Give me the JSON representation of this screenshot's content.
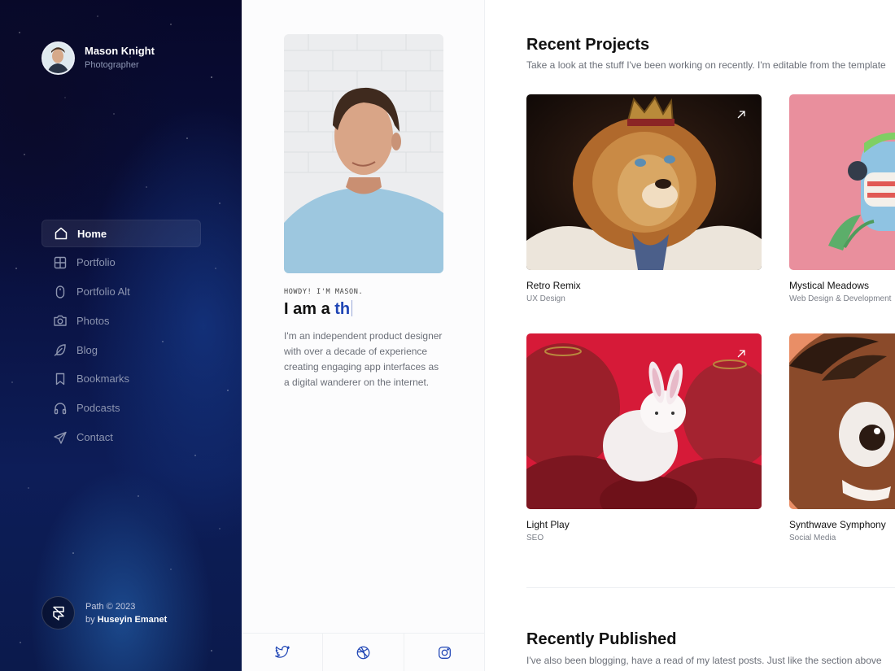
{
  "profile": {
    "name": "Mason Knight",
    "role": "Photographer"
  },
  "nav": {
    "items": [
      {
        "label": "Home",
        "icon": "home-icon",
        "active": true
      },
      {
        "label": "Portfolio",
        "icon": "grid-icon"
      },
      {
        "label": "Portfolio Alt",
        "icon": "mouse-icon"
      },
      {
        "label": "Photos",
        "icon": "camera-icon"
      },
      {
        "label": "Blog",
        "icon": "feather-icon"
      },
      {
        "label": "Bookmarks",
        "icon": "bookmark-icon"
      },
      {
        "label": "Podcasts",
        "icon": "headphones-icon"
      },
      {
        "label": "Contact",
        "icon": "send-icon"
      }
    ]
  },
  "footer": {
    "line1": "Path © 2023",
    "by": "by",
    "author": "Huseyin Emanet"
  },
  "intro": {
    "howdy": "HOWDY! I'M MASON.",
    "headline_prefix": "I am a ",
    "headline_typed": "th",
    "bio": "I'm an independent product designer with over a decade of experience creating engaging app interfaces as a digital wanderer on the internet."
  },
  "social": [
    "twitter-icon",
    "dribbble-icon",
    "instagram-icon"
  ],
  "projects": {
    "title": "Recent Projects",
    "subtitle": "Take a look at the stuff I've been working on recently. I'm editable from the template",
    "items": [
      {
        "title": "Retro Remix",
        "category": "UX Design"
      },
      {
        "title": "Mystical Meadows",
        "category": "Web Design & Development"
      },
      {
        "title": "Light Play",
        "category": "SEO"
      },
      {
        "title": "Synthwave Symphony",
        "category": "Social Media"
      }
    ]
  },
  "published": {
    "title": "Recently Published",
    "subtitle": "I've also been blogging, have a read of my latest posts. Just like the section above"
  },
  "colors": {
    "accent": "#1f45b5",
    "sidebar_bg": "#0a1140"
  }
}
